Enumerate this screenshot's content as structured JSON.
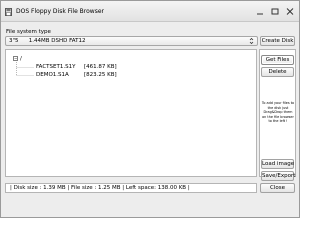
{
  "window": {
    "title": "DOS Floppy Disk File Browser"
  },
  "filesystem": {
    "label": "File system type",
    "drive": "3\"5",
    "format": "1.44MB DSHD FAT12"
  },
  "buttons": {
    "create_disk": "Create Disk",
    "get_files": "Get Files",
    "delete": "Delete",
    "load_image": "Load image",
    "save_export": "Save/Export",
    "close": "Close"
  },
  "tree": {
    "root_toggle": "−",
    "root": "/",
    "files": [
      {
        "name": "FACTSET1.S1Y",
        "size": "[461.87 KB]"
      },
      {
        "name": "DEMO1.S1A",
        "size": "[823.25 KB]"
      }
    ]
  },
  "hint": "To add your files to the disk just Drag&Drop them on the file browser to the left !",
  "status": {
    "text": "| Disk size : 1.39 MB | File size : 1.25 MB | Left space: 138.00 KB |"
  },
  "icons": {
    "app": "floppy-icon",
    "minimize": "minimize-icon",
    "maximize": "maximize-icon",
    "close": "close-icon",
    "select_arrows": "updown-chevron-icon"
  }
}
